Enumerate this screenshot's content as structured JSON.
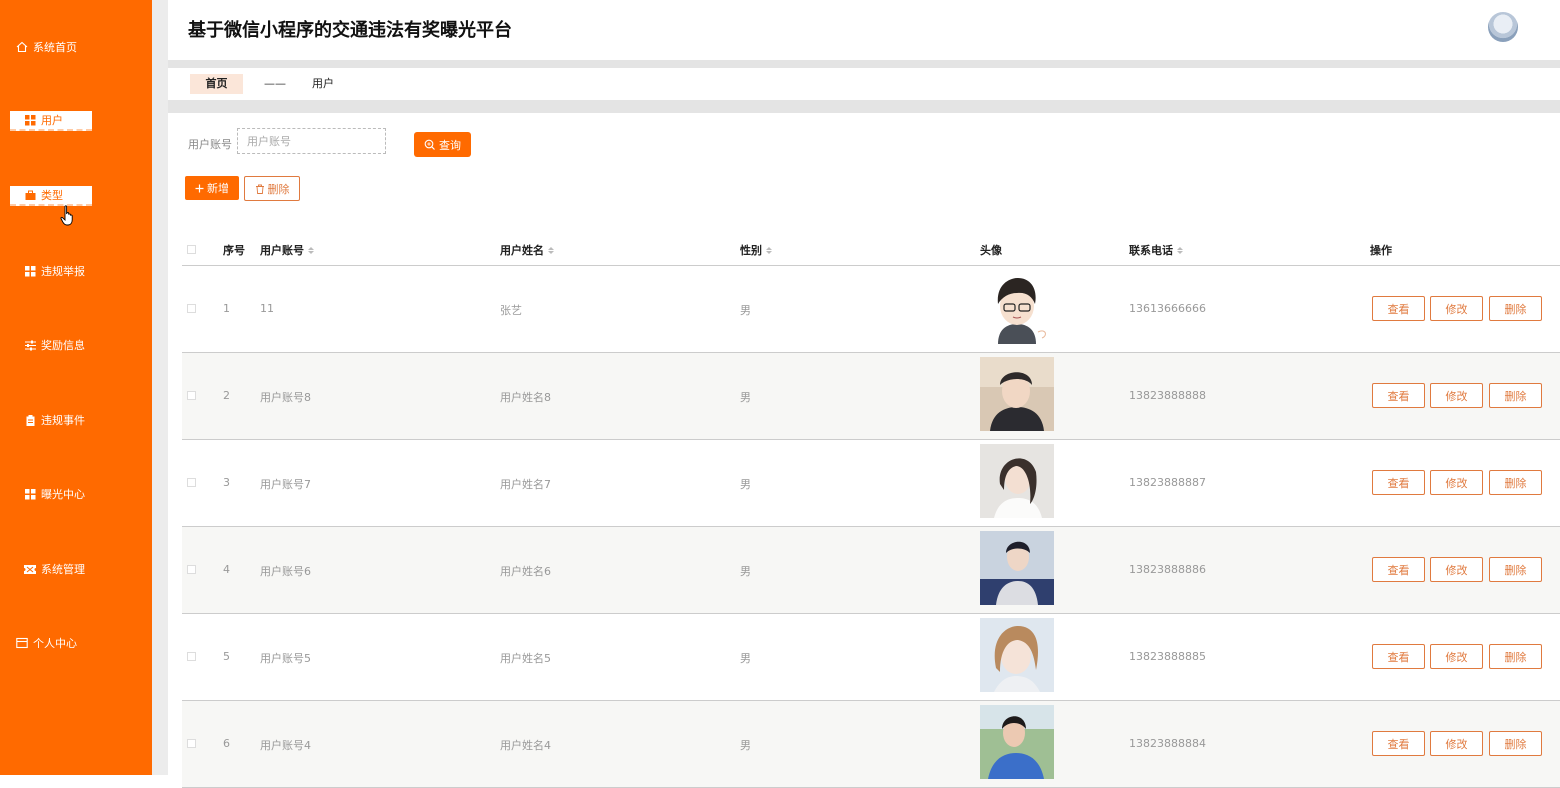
{
  "app": {
    "title": "基于微信小程序的交通违法有奖曝光平台"
  },
  "sidebar": {
    "items": [
      {
        "label": "系统首页",
        "icon": "home-icon"
      },
      {
        "label": "用户",
        "icon": "grid-icon"
      },
      {
        "label": "类型",
        "icon": "briefcase-icon"
      },
      {
        "label": "违规举报",
        "icon": "grid-icon"
      },
      {
        "label": "奖励信息",
        "icon": "sliders-icon"
      },
      {
        "label": "违规事件",
        "icon": "clipboard-icon"
      },
      {
        "label": "曝光中心",
        "icon": "grid-icon"
      },
      {
        "label": "系统管理",
        "icon": "ticket-icon"
      },
      {
        "label": "个人中心",
        "icon": "card-icon"
      }
    ]
  },
  "breadcrumb": {
    "home": "首页",
    "separator": "——",
    "current": "用户"
  },
  "search": {
    "label": "用户账号",
    "placeholder": "用户账号",
    "query_label": "查询"
  },
  "toolbar": {
    "add_label": "新增",
    "delete_label": "删除"
  },
  "table": {
    "headers": {
      "index": "序号",
      "account": "用户账号",
      "name": "用户姓名",
      "gender": "性别",
      "avatar": "头像",
      "phone": "联系电话",
      "actions": "操作"
    },
    "actions": {
      "view": "查看",
      "edit": "修改",
      "delete": "删除"
    },
    "rows": [
      {
        "index": "1",
        "account": "11",
        "name": "张艺",
        "gender": "男",
        "phone": "13613666666"
      },
      {
        "index": "2",
        "account": "用户账号8",
        "name": "用户姓名8",
        "gender": "男",
        "phone": "13823888888"
      },
      {
        "index": "3",
        "account": "用户账号7",
        "name": "用户姓名7",
        "gender": "男",
        "phone": "13823888887"
      },
      {
        "index": "4",
        "account": "用户账号6",
        "name": "用户姓名6",
        "gender": "男",
        "phone": "13823888886"
      },
      {
        "index": "5",
        "account": "用户账号5",
        "name": "用户姓名5",
        "gender": "男",
        "phone": "13823888885"
      },
      {
        "index": "6",
        "account": "用户账号4",
        "name": "用户姓名4",
        "gender": "男",
        "phone": "13823888884"
      }
    ]
  },
  "colors": {
    "accent": "#ff6a00",
    "outline": "#e07a3f"
  }
}
